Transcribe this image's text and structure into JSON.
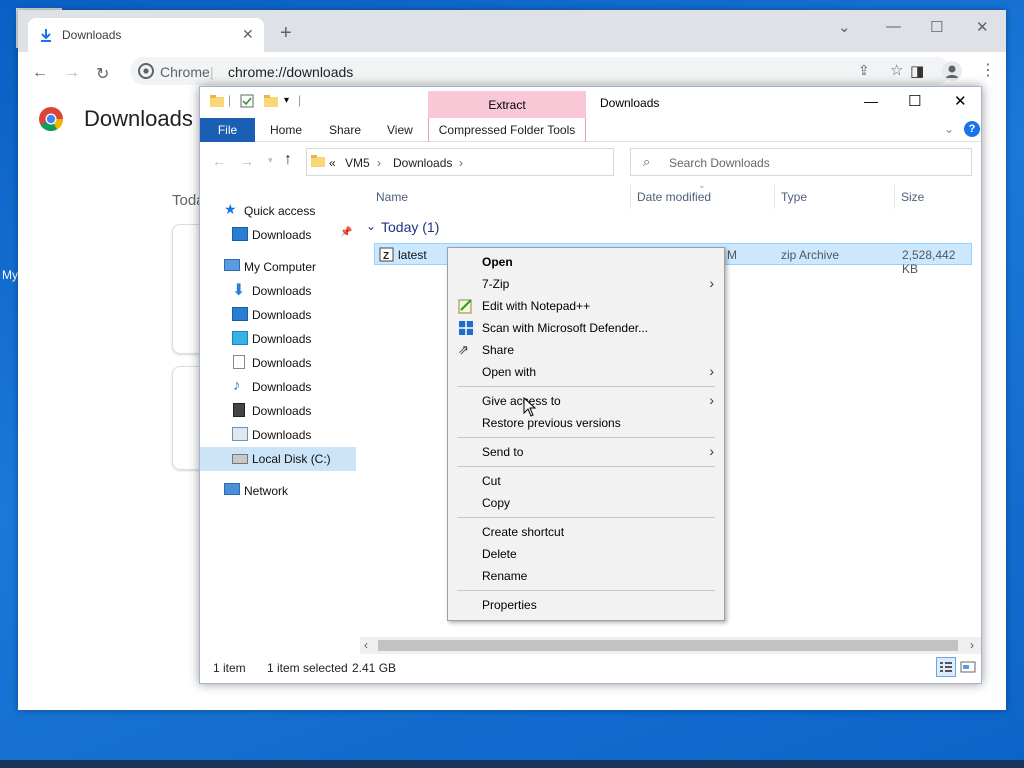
{
  "desktop": {
    "icon_label": "My"
  },
  "chrome": {
    "tab_title": "Downloads",
    "omnibox_label": "Chrome",
    "omnibox_url": "chrome://downloads",
    "page_title": "Downloads",
    "section_today": "Toda"
  },
  "explorer": {
    "contextual_tab": "Extract",
    "window_title": "Downloads",
    "ribbon_tabs": [
      "File",
      "Home",
      "Share",
      "View",
      "Compressed Folder Tools"
    ],
    "path": [
      "«",
      "VM5",
      "Downloads"
    ],
    "search_placeholder": "Search Downloads",
    "nav": [
      {
        "label": "Quick access",
        "icon": "star-icon"
      },
      {
        "label": "Downloads",
        "icon": "desktop-folder-icon"
      },
      {
        "label": "My Computer",
        "icon": "computer-icon"
      },
      {
        "label": "Downloads",
        "icon": "download-arrow-icon"
      },
      {
        "label": "Downloads",
        "icon": "desktop-folder-icon"
      },
      {
        "label": "Downloads",
        "icon": "3d-objects-icon"
      },
      {
        "label": "Downloads",
        "icon": "document-icon"
      },
      {
        "label": "Downloads",
        "icon": "music-note-icon"
      },
      {
        "label": "Downloads",
        "icon": "film-icon"
      },
      {
        "label": "Downloads",
        "icon": "pictures-icon"
      },
      {
        "label": "Local Disk (C:)",
        "icon": "drive-icon"
      },
      {
        "label": "Network",
        "icon": "network-icon"
      }
    ],
    "columns": [
      "Name",
      "Date modified",
      "Type",
      "Size"
    ],
    "group_label": "Today (1)",
    "file": {
      "name": "latest",
      "date_fragment": "M",
      "type": "zip Archive",
      "size": "2,528,442 KB"
    },
    "status": {
      "count": "1 item",
      "selected": "1 item selected",
      "size": "2.41 GB"
    }
  },
  "context_menu": {
    "items": [
      "Open",
      "7-Zip",
      "Edit with Notepad++",
      "Scan with Microsoft Defender...",
      "Share",
      "Open with",
      "Give access to",
      "Restore previous versions",
      "Send to",
      "Cut",
      "Copy",
      "Create shortcut",
      "Delete",
      "Rename",
      "Properties"
    ]
  }
}
